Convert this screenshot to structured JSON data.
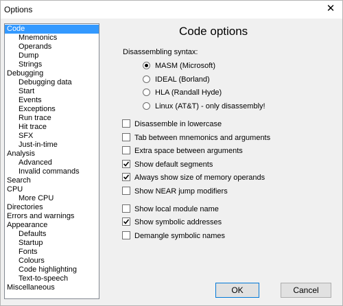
{
  "window": {
    "title": "Options",
    "close_label": "✕"
  },
  "tree": {
    "items": [
      {
        "label": "Code",
        "level": 0,
        "selected": true
      },
      {
        "label": "Mnemonics",
        "level": 1
      },
      {
        "label": "Operands",
        "level": 1
      },
      {
        "label": "Dump",
        "level": 1
      },
      {
        "label": "Strings",
        "level": 1
      },
      {
        "label": "Debugging",
        "level": 0
      },
      {
        "label": "Debugging data",
        "level": 1
      },
      {
        "label": "Start",
        "level": 1
      },
      {
        "label": "Events",
        "level": 1
      },
      {
        "label": "Exceptions",
        "level": 1
      },
      {
        "label": "Run trace",
        "level": 1
      },
      {
        "label": "Hit trace",
        "level": 1
      },
      {
        "label": "SFX",
        "level": 1
      },
      {
        "label": "Just-in-time",
        "level": 1
      },
      {
        "label": "Analysis",
        "level": 0
      },
      {
        "label": "Advanced",
        "level": 1
      },
      {
        "label": "Invalid commands",
        "level": 1
      },
      {
        "label": "Search",
        "level": 0
      },
      {
        "label": "CPU",
        "level": 0
      },
      {
        "label": "More CPU",
        "level": 1
      },
      {
        "label": "Directories",
        "level": 0
      },
      {
        "label": "Errors and warnings",
        "level": 0
      },
      {
        "label": "Appearance",
        "level": 0
      },
      {
        "label": "Defaults",
        "level": 1
      },
      {
        "label": "Startup",
        "level": 1
      },
      {
        "label": "Fonts",
        "level": 1
      },
      {
        "label": "Colours",
        "level": 1
      },
      {
        "label": "Code highlighting",
        "level": 1
      },
      {
        "label": "Text-to-speech",
        "level": 1
      },
      {
        "label": "Miscellaneous",
        "level": 0
      }
    ]
  },
  "panel": {
    "title": "Code options",
    "syntax_label": "Disassembling syntax:",
    "syntax_options": [
      {
        "label": "MASM (Microsoft)",
        "selected": true
      },
      {
        "label": "IDEAL (Borland)",
        "selected": false
      },
      {
        "label": "HLA (Randall Hyde)",
        "selected": false
      },
      {
        "label": "Linux (AT&T) - only disassembly!",
        "selected": false
      }
    ],
    "checkbox_groups": [
      [
        {
          "label": "Disassemble in lowercase",
          "checked": false
        },
        {
          "label": "Tab between mnemonics and arguments",
          "checked": false
        },
        {
          "label": "Extra space between arguments",
          "checked": false
        },
        {
          "label": "Show default segments",
          "checked": true
        },
        {
          "label": "Always show size of memory operands",
          "checked": true
        },
        {
          "label": "Show NEAR jump modifiers",
          "checked": false
        }
      ],
      [
        {
          "label": "Show local module name",
          "checked": false
        },
        {
          "label": "Show symbolic addresses",
          "checked": true
        },
        {
          "label": "Demangle symbolic names",
          "checked": false
        }
      ]
    ]
  },
  "buttons": {
    "ok": "OK",
    "cancel": "Cancel"
  }
}
